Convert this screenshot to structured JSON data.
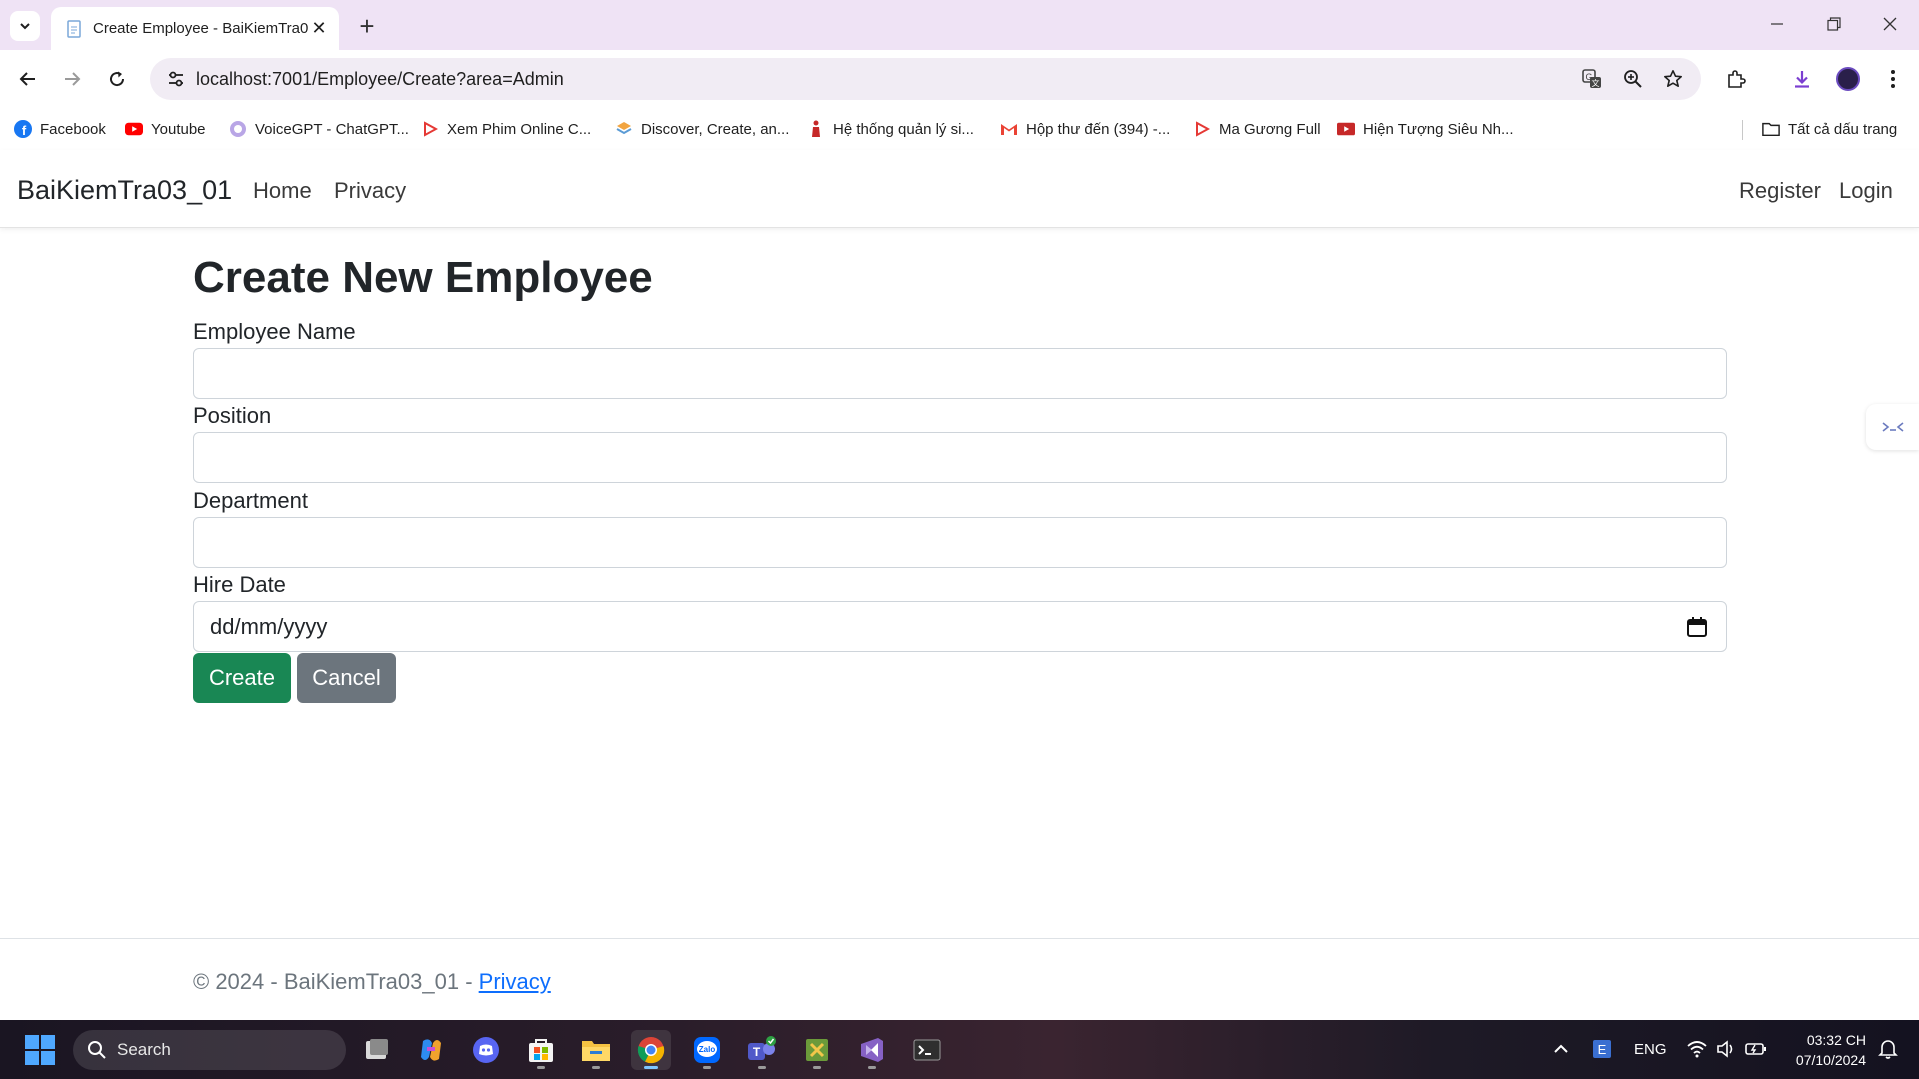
{
  "browser": {
    "tab_title": "Create Employee - BaiKiemTra03_01",
    "url": "localhost:7001/Employee/Create?area=Admin",
    "bookmarks": [
      {
        "label": "Facebook",
        "icon": "facebook-icon"
      },
      {
        "label": "Youtube",
        "icon": "youtube-icon"
      },
      {
        "label": "VoiceGPT - ChatGPT...",
        "icon": "voicegpt-icon"
      },
      {
        "label": "Xem Phim Online C...",
        "icon": "play-icon"
      },
      {
        "label": "Discover, Create, an...",
        "icon": "layers-icon"
      },
      {
        "label": "Hệ thống quản lý si...",
        "icon": "student-icon"
      },
      {
        "label": "Hộp thư đến (394) -...",
        "icon": "gmail-icon"
      },
      {
        "label": "Ma Gương Full",
        "icon": "play-icon"
      },
      {
        "label": "Hiện Tượng Siêu Nh...",
        "icon": "youtube-icon"
      }
    ],
    "all_bookmarks_label": "Tất cả dấu trang"
  },
  "site": {
    "brand": "BaiKiemTra03_01",
    "nav": {
      "home": "Home",
      "privacy": "Privacy",
      "register": "Register",
      "login": "Login"
    }
  },
  "form": {
    "title": "Create New Employee",
    "employee_name_label": "Employee Name",
    "employee_name_value": "",
    "position_label": "Position",
    "position_value": "",
    "department_label": "Department",
    "department_value": "",
    "hire_date_label": "Hire Date",
    "hire_date_placeholder": "dd/mm/yyyy",
    "create_label": "Create",
    "cancel_label": "Cancel"
  },
  "footer": {
    "text": "© 2024 - BaiKiemTra03_01 - ",
    "privacy_link": "Privacy"
  },
  "taskbar": {
    "search_label": "Search",
    "language": "ENG",
    "time": "03:32 CH",
    "date": "07/10/2024"
  },
  "colors": {
    "tabstrip": "#efe3f5",
    "create_button": "#198754",
    "cancel_button": "#6c757d",
    "link": "#0d6efd"
  }
}
